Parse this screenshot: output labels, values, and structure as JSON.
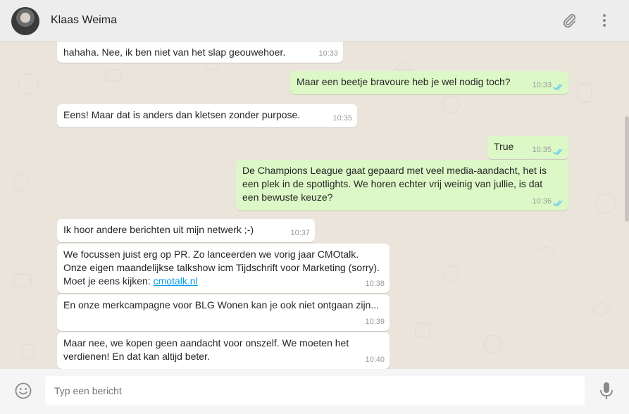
{
  "header": {
    "contact_name": "Klaas Weima",
    "icons": [
      "avatar",
      "paperclip-icon",
      "menu-dots-icon"
    ]
  },
  "messages": [
    {
      "dir": "in",
      "text": "hahaha. Nee, ik ben niet van het slap geouwehoer.",
      "time": "10:33"
    },
    {
      "dir": "out",
      "text": "Maar een beetje bravoure heb je wel nodig toch?",
      "time": "10:33",
      "read": true
    },
    {
      "dir": "in",
      "text": "Eens! Maar dat is anders dan kletsen zonder purpose.",
      "time": "10:35"
    },
    {
      "dir": "out",
      "text": "True",
      "time": "10:35",
      "read": true
    },
    {
      "dir": "out",
      "text": "De Champions League gaat gepaard met veel media-aandacht, het is een plek in de spotlights. We horen echter vrij weinig van jullie, is dat een bewuste keuze?",
      "time": "10:36",
      "read": true
    },
    {
      "dir": "in",
      "text": "Ik hoor andere berichten uit mijn netwerk ;-)",
      "time": "10:37"
    },
    {
      "dir": "in",
      "text": "We focussen juist erg op PR. Zo lanceerden we vorig jaar CMOtalk. Onze eigen maandelijkse talkshow icm Tijdschrift voor Marketing (sorry). Moet je eens kijken: ",
      "link": "cmotalk.nl",
      "time": "10:38"
    },
    {
      "dir": "in",
      "text": "En onze merkcampagne voor BLG Wonen kan je ook niet ontgaan zijn...",
      "time": "10:39"
    },
    {
      "dir": "in",
      "text": "Maar nee, we kopen geen aandacht voor onszelf. We moeten het verdienen! En dat kan altijd beter.",
      "time": "10:40"
    }
  ],
  "composer": {
    "placeholder": "Typ een bericht",
    "icons": [
      "emoji-icon",
      "microphone-icon"
    ]
  },
  "colors": {
    "incoming_bubble": "#ffffff",
    "outgoing_bubble": "#dcf8c6",
    "read_ticks": "#4fc3f7",
    "chat_background": "#ece5dd"
  }
}
